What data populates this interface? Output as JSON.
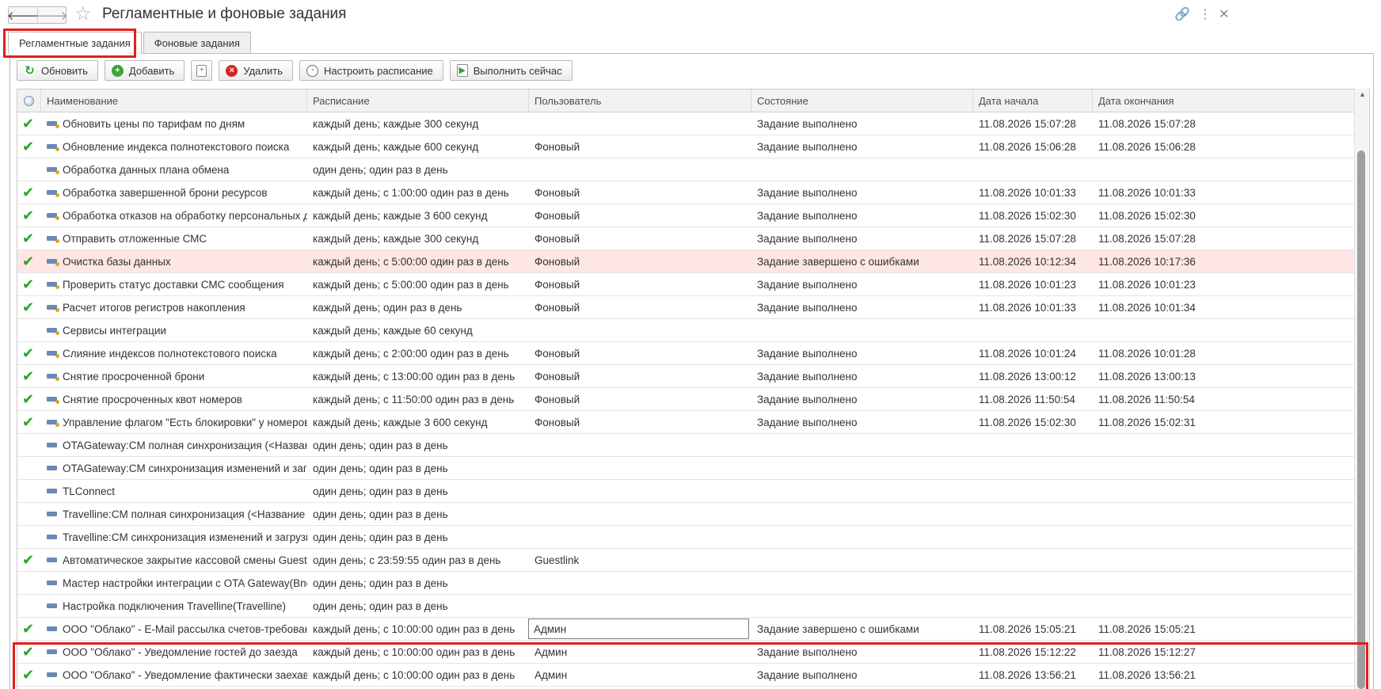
{
  "window": {
    "title": "Регламентные и фоновые задания",
    "back_icon": "arrow-left-icon",
    "forward_icon": "arrow-right-icon",
    "favorite_icon": "star-icon",
    "link_icon": "link-icon",
    "more_icon": "more-vertical-icon",
    "close_icon": "close-icon"
  },
  "tabs": [
    {
      "label": "Регламентные задания",
      "active": true
    },
    {
      "label": "Фоновые задания",
      "active": false
    }
  ],
  "toolbar": {
    "refresh_label": "Обновить",
    "add_label": "Добавить",
    "copy_icon": "copy-icon",
    "delete_label": "Удалить",
    "schedule_label": "Настроить расписание",
    "run_now_label": "Выполнить сейчас"
  },
  "columns": {
    "state_icon": "state-icon",
    "name": "Наименование",
    "schedule": "Расписание",
    "user": "Пользователь",
    "status": "Состояние",
    "start": "Дата начала",
    "end": "Дата окончания"
  },
  "accent_colors": {
    "check": "#22a822",
    "error_row": "#fde6e4",
    "highlight": "#e0201b"
  },
  "rows": [
    {
      "done": true,
      "icon": "key",
      "name": "Обновить цены по тарифам по дням",
      "schedule": "каждый день; каждые 300 секунд",
      "user": "",
      "status": "Задание выполнено",
      "start": "11.08.2026 15:07:28",
      "end": "11.08.2026 15:07:28"
    },
    {
      "done": true,
      "icon": "key",
      "name": "Обновление индекса полнотекстового поиска",
      "schedule": "каждый день; каждые 600 секунд",
      "user": "Фоновый",
      "status": "Задание выполнено",
      "start": "11.08.2026 15:06:28",
      "end": "11.08.2026 15:06:28"
    },
    {
      "done": false,
      "icon": "key",
      "name": "Обработка данных плана обмена",
      "schedule": "один день; один раз в день",
      "user": "",
      "status": "",
      "start": "",
      "end": ""
    },
    {
      "done": true,
      "icon": "key",
      "name": "Обработка завершенной брони ресурсов",
      "schedule": "каждый день; с 1:00:00 один раз в день",
      "user": "Фоновый",
      "status": "Задание выполнено",
      "start": "11.08.2026 10:01:33",
      "end": "11.08.2026 10:01:33"
    },
    {
      "done": true,
      "icon": "key",
      "name": "Обработка отказов на обработку персональных данных",
      "schedule": "каждый день; каждые 3 600 секунд",
      "user": "Фоновый",
      "status": "Задание выполнено",
      "start": "11.08.2026 15:02:30",
      "end": "11.08.2026 15:02:30"
    },
    {
      "done": true,
      "icon": "key",
      "name": "Отправить отложенные СМС",
      "schedule": "каждый день; каждые 300 секунд",
      "user": "Фоновый",
      "status": "Задание выполнено",
      "start": "11.08.2026 15:07:28",
      "end": "11.08.2026 15:07:28"
    },
    {
      "done": true,
      "icon": "key",
      "error": true,
      "name": "Очистка базы данных",
      "schedule": "каждый день; с 5:00:00 один раз в день",
      "user": "Фоновый",
      "status": "Задание завершено с ошибками",
      "start": "11.08.2026 10:12:34",
      "end": "11.08.2026 10:17:36"
    },
    {
      "done": true,
      "icon": "key",
      "name": "Проверить статус доставки СМС сообщения",
      "schedule": "каждый день; с 5:00:00 один раз в день",
      "user": "Фоновый",
      "status": "Задание выполнено",
      "start": "11.08.2026 10:01:23",
      "end": "11.08.2026 10:01:23"
    },
    {
      "done": true,
      "icon": "key",
      "name": "Расчет итогов регистров накопления",
      "schedule": "каждый день; один раз в день",
      "user": "Фоновый",
      "status": "Задание выполнено",
      "start": "11.08.2026 10:01:33",
      "end": "11.08.2026 10:01:34"
    },
    {
      "done": false,
      "icon": "key",
      "name": "Сервисы интеграции",
      "schedule": "каждый день; каждые 60 секунд",
      "user": "",
      "status": "",
      "start": "",
      "end": ""
    },
    {
      "done": true,
      "icon": "key",
      "name": "Слияние индексов полнотекстового поиска",
      "schedule": "каждый день; с 2:00:00 один раз в день",
      "user": "Фоновый",
      "status": "Задание выполнено",
      "start": "11.08.2026 10:01:24",
      "end": "11.08.2026 10:01:28"
    },
    {
      "done": true,
      "icon": "key",
      "name": "Снятие просроченной брони",
      "schedule": "каждый день; с 13:00:00 один раз в день",
      "user": "Фоновый",
      "status": "Задание выполнено",
      "start": "11.08.2026 13:00:12",
      "end": "11.08.2026 13:00:13"
    },
    {
      "done": true,
      "icon": "key",
      "name": "Снятие просроченных квот номеров",
      "schedule": "каждый день; с 11:50:00 один раз в день",
      "user": "Фоновый",
      "status": "Задание выполнено",
      "start": "11.08.2026 11:50:54",
      "end": "11.08.2026 11:50:54"
    },
    {
      "done": true,
      "icon": "key",
      "name": "Управление флагом \"Есть блокировки\" у номеров в ...",
      "schedule": "каждый день; каждые 3 600 секунд",
      "user": "Фоновый",
      "status": "Задание выполнено",
      "start": "11.08.2026 15:02:30",
      "end": "11.08.2026 15:02:31"
    },
    {
      "done": false,
      "icon": "plain",
      "name": "OTAGateway:CM полная синхронизация (<Название ...",
      "schedule": "один день; один раз в день",
      "user": "",
      "status": "",
      "start": "",
      "end": ""
    },
    {
      "done": false,
      "icon": "plain",
      "name": "OTAGateway:CM синхронизация изменений и загруз...",
      "schedule": "один день; один раз в день",
      "user": "",
      "status": "",
      "start": "",
      "end": ""
    },
    {
      "done": false,
      "icon": "plain",
      "name": "TLConnect",
      "schedule": "один день; один раз в день",
      "user": "",
      "status": "",
      "start": "",
      "end": ""
    },
    {
      "done": false,
      "icon": "plain",
      "name": "Travelline:CM полная синхронизация (<Название ваш...",
      "schedule": "один день; один раз в день",
      "user": "",
      "status": "",
      "start": "",
      "end": ""
    },
    {
      "done": false,
      "icon": "plain",
      "name": "Travelline:CM синхронизация изменений и загрузка б...",
      "schedule": "один день; один раз в день",
      "user": "",
      "status": "",
      "start": "",
      "end": ""
    },
    {
      "done": true,
      "icon": "plain",
      "name": "Автоматическое закрытие кассовой смены Guestlink",
      "schedule": "один день; с 23:59:55 один раз в день",
      "user": "Guestlink",
      "status": "",
      "start": "",
      "end": ""
    },
    {
      "done": false,
      "icon": "plain",
      "name": "Мастер настройки интеграции с OTA Gateway(Bnovo)",
      "schedule": "один день; один раз в день",
      "user": "",
      "status": "",
      "start": "",
      "end": ""
    },
    {
      "done": false,
      "icon": "plain",
      "name": "Настройка подключения Travelline(Travelline)",
      "schedule": "один день; один раз в день",
      "user": "",
      "status": "",
      "start": "",
      "end": ""
    },
    {
      "done": true,
      "icon": "plain",
      "focused_user": true,
      "name": "ООО \"Облако\" - E-Mail рассылка счетов-требований,...",
      "schedule": "каждый день; с 10:00:00 один раз в день",
      "user": "Админ",
      "status": "Задание завершено с ошибками",
      "start": "11.08.2026 15:05:21",
      "end": "11.08.2026 15:05:21"
    },
    {
      "done": true,
      "icon": "plain",
      "name": "ООО \"Облако\" - Уведомление гостей до заезда",
      "schedule": "каждый день; с 10:00:00 один раз в день",
      "user": "Админ",
      "status": "Задание выполнено",
      "start": "11.08.2026 15:12:22",
      "end": "11.08.2026 15:12:27"
    },
    {
      "done": true,
      "icon": "plain",
      "name": "ООО \"Облако\" - Уведомление фактически заехавши...",
      "schedule": "каждый день; с 10:00:00 один раз в день",
      "user": "Админ",
      "status": "Задание выполнено",
      "start": "11.08.2026 13:56:21",
      "end": "11.08.2026 13:56:21"
    }
  ]
}
